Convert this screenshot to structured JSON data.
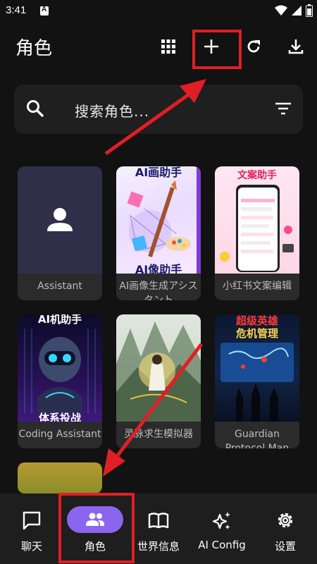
{
  "status_bar": {
    "time": "3:41"
  },
  "app_bar": {
    "title": "角色",
    "icons": [
      "grid-icon",
      "add-icon",
      "refresh-icon",
      "download-icon"
    ]
  },
  "search": {
    "placeholder": "搜索角色..."
  },
  "characters": [
    {
      "name": "Assistant"
    },
    {
      "name": "AI画像生成アシスタント",
      "image_text_top": "AI画助手",
      "image_text_bottom": "AI像助手"
    },
    {
      "name": "小红书文案编辑",
      "image_text_top": "文案助手"
    },
    {
      "name": "Coding Assistant",
      "image_text_top": "AI机助手",
      "image_text_bottom": "体系投战"
    },
    {
      "name": "灵脉求生模拟器"
    },
    {
      "name": "Guardian Protocol Man",
      "image_text_top": "超级英雄",
      "image_text_top2": "危机管理"
    },
    {
      "name": ""
    }
  ],
  "bottom_nav": [
    {
      "label": "聊天",
      "icon": "chat-icon"
    },
    {
      "label": "角色",
      "icon": "people-icon"
    },
    {
      "label": "世界信息",
      "icon": "book-icon"
    },
    {
      "label": "AI Config",
      "icon": "sparkle-icon"
    },
    {
      "label": "设置",
      "icon": "gear-icon"
    }
  ],
  "colors": {
    "accent": "#8b65f0",
    "annotation_red": "#e01e26",
    "background": "#121212"
  }
}
